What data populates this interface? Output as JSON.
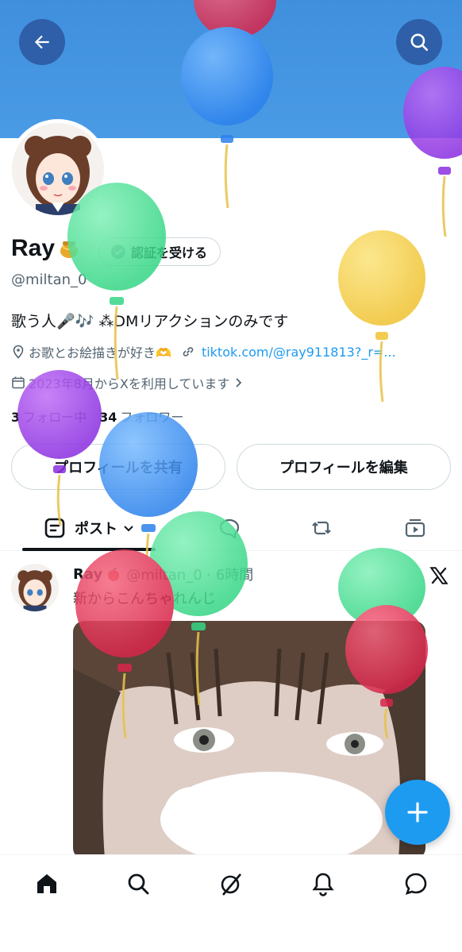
{
  "profile": {
    "name": "Ray",
    "verify_label": "認証を受ける",
    "handle": "@miltan_0",
    "bio": "歌う人🎤🎶 ⁂DMリアクションのみです",
    "location": "お歌とお絵描きが好き🫶",
    "link": "tiktok.com/@ray911813?_r=...",
    "joined": "2023年8月からXを利用しています",
    "following_count": "3",
    "following_label": "フォロー中",
    "followers_count": "34",
    "followers_label": "フォロワー",
    "share_label": "プロフィールを共有",
    "edit_label": "プロフィールを編集"
  },
  "tabs": {
    "posts_label": "ポスト"
  },
  "post": {
    "author": "Ray",
    "meta": "@miltan_0 · 6時間",
    "text": "新からこんちゃれんじ"
  },
  "icons": {
    "back": "arrow-left-icon",
    "search": "search-icon",
    "fab": "plus-icon",
    "nav": [
      "home-icon",
      "search-icon",
      "grok-icon",
      "bell-icon",
      "message-icon"
    ]
  },
  "colors": {
    "banner": "#4a9be6",
    "accent": "#1d9bf0",
    "text": "#0f1419",
    "muted": "#536471"
  }
}
